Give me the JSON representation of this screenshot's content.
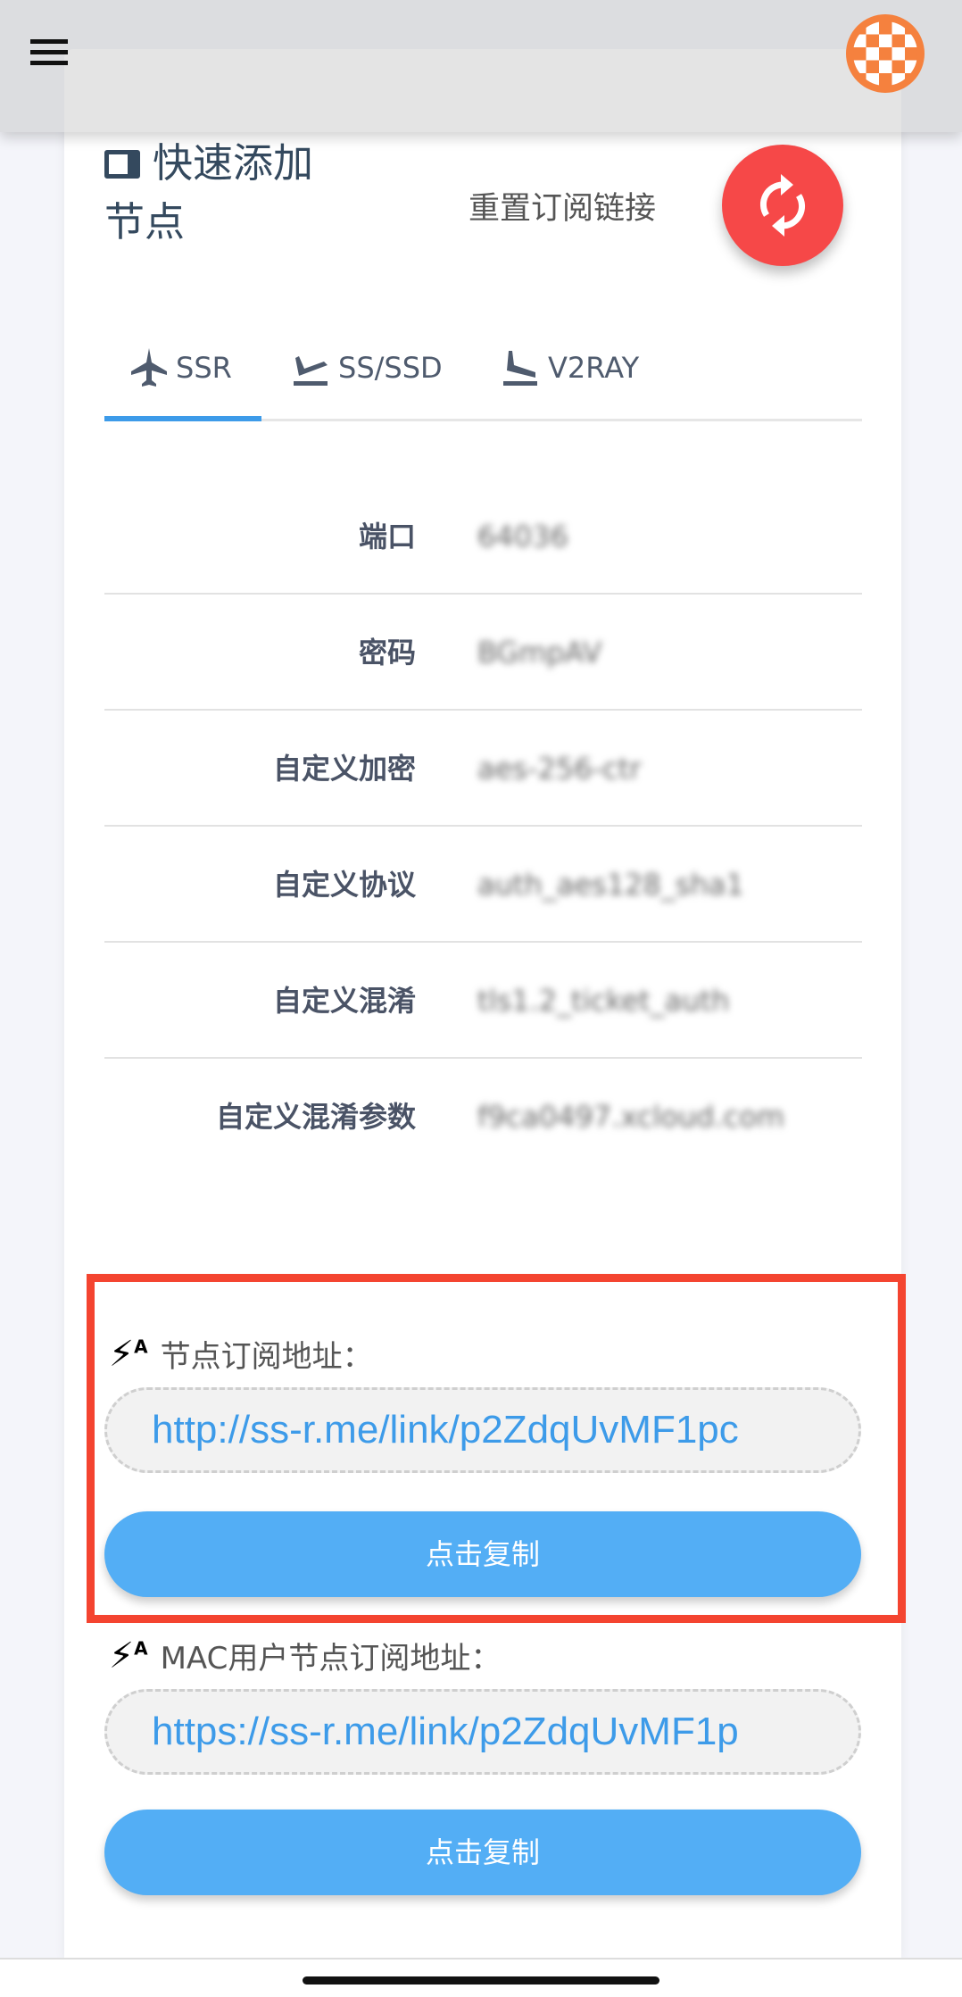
{
  "header": {
    "menu_icon": "hamburger-icon",
    "avatar": "identicon-avatar"
  },
  "card": {
    "title": "快速添加节点",
    "reset_label": "重置订阅链接",
    "tabs": [
      {
        "label": "SSR",
        "icon": "plane-icon",
        "active": true
      },
      {
        "label": "SS/SSD",
        "icon": "plane-takeoff-icon"
      },
      {
        "label": "V2RAY",
        "icon": "plane-landing-icon"
      }
    ],
    "rows": [
      {
        "label": "端口",
        "value": "64036"
      },
      {
        "label": "密码",
        "value": "BGmpAV"
      },
      {
        "label": "自定义加密",
        "value": "aes-256-ctr"
      },
      {
        "label": "自定义协议",
        "value": "auth_aes128_sha1"
      },
      {
        "label": "自定义混淆",
        "value": "tls1.2_ticket_auth"
      },
      {
        "label": "自定义混淆参数",
        "value": "f9ca0497.xcloud.com"
      }
    ],
    "subscriptions": [
      {
        "label": "节点订阅地址：",
        "url": "http://ss-r.me/link/p2ZdqUvMF1pc",
        "copy": "点击复制"
      },
      {
        "label": "MAC用户节点订阅地址：",
        "url": "https://ss-r.me/link/p2ZdqUvMF1p",
        "copy": "点击复制"
      }
    ]
  },
  "colors": {
    "accent": "#3d9be9",
    "button": "#53aef5",
    "reset": "#f64848",
    "highlight": "#f44430"
  }
}
